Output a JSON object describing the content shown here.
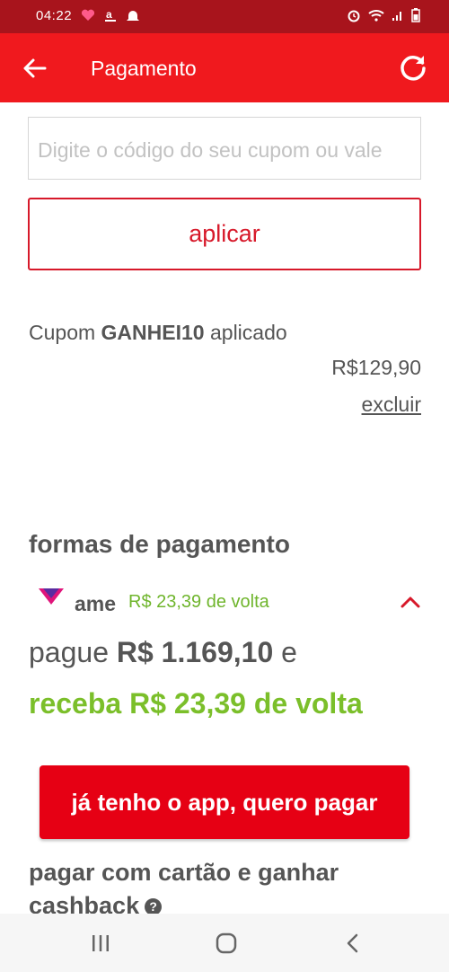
{
  "status_bar": {
    "time": "04:22",
    "left_icons": [
      "heart-icon",
      "amazon-icon",
      "bell-icon"
    ],
    "right_icons": [
      "alarm-icon",
      "wifi-icon",
      "signal-icon",
      "battery-icon"
    ]
  },
  "app_bar": {
    "title": "Pagamento",
    "back_icon": "arrow-left-icon",
    "refresh_icon": "refresh-icon"
  },
  "coupon": {
    "input_placeholder": "Digite o código do seu cupom ou vale",
    "input_value": "",
    "apply_label": "aplicar",
    "applied_prefix": "Cupom",
    "applied_code": "GANHEI10",
    "applied_suffix": "aplicado",
    "value": "R$129,90",
    "remove_label": "excluir"
  },
  "payment": {
    "section_title": "formas de pagamento",
    "ame": {
      "name": "ame",
      "cashback_label": "R$ 23,39 de volta",
      "pay_prefix": "pague",
      "pay_amount": "R$ 1.169,10",
      "pay_suffix": "e",
      "receive_line": "receba R$ 23,39 de volta",
      "app_button_label": "já tenho o app, quero pagar"
    },
    "card_cashback_label": "pagar com cartão e ganhar cashback"
  },
  "colors": {
    "status_bar": "#a8141c",
    "app_bar": "#f0191e",
    "accent_red": "#e60014",
    "cashback_green": "#7bbf2a"
  },
  "nav_bar": {
    "icons": [
      "recents-icon",
      "home-icon",
      "back-icon"
    ]
  }
}
